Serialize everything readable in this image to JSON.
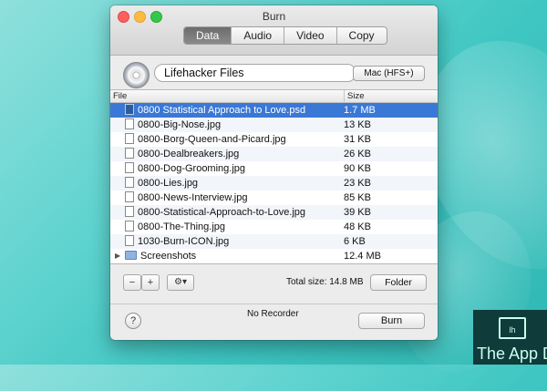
{
  "window": {
    "title": "Burn",
    "tabs": [
      {
        "label": "Data",
        "active": true
      },
      {
        "label": "Audio",
        "active": false
      },
      {
        "label": "Video",
        "active": false
      },
      {
        "label": "Copy",
        "active": false
      }
    ]
  },
  "disc": {
    "name": "Lifehacker Files",
    "filesystem": "Mac (HFS+)"
  },
  "filelist": {
    "columns": [
      "File",
      "Size"
    ],
    "rows": [
      {
        "name": "0800 Statistical Approach to Love.psd",
        "size": "1.7 MB",
        "icon": "psd-file-icon",
        "selected": true
      },
      {
        "name": "0800-Big-Nose.jpg",
        "size": "13 KB",
        "icon": "image-file-icon"
      },
      {
        "name": "0800-Borg-Queen-and-Picard.jpg",
        "size": "31 KB",
        "icon": "image-file-icon"
      },
      {
        "name": "0800-Dealbreakers.jpg",
        "size": "26 KB",
        "icon": "image-file-icon"
      },
      {
        "name": "0800-Dog-Grooming.jpg",
        "size": "90 KB",
        "icon": "image-file-icon"
      },
      {
        "name": "0800-Lies.jpg",
        "size": "23 KB",
        "icon": "image-file-icon"
      },
      {
        "name": "0800-News-Interview.jpg",
        "size": "85 KB",
        "icon": "image-file-icon"
      },
      {
        "name": "0800-Statistical-Approach-to-Love.jpg",
        "size": "39 KB",
        "icon": "image-file-icon"
      },
      {
        "name": "0800-The-Thing.jpg",
        "size": "48 KB",
        "icon": "image-file-icon"
      },
      {
        "name": "1030-Burn-ICON.jpg",
        "size": "6 KB",
        "icon": "image-file-icon"
      },
      {
        "name": "Screenshots",
        "size": "12.4 MB",
        "icon": "folder-icon",
        "disclosure": "▶"
      }
    ]
  },
  "toolbar": {
    "remove_label": "−",
    "add_label": "+",
    "action_label": "⚙▾",
    "total_size": "Total size: 14.8 MB",
    "folder_label": "Folder"
  },
  "footer": {
    "help_label": "?",
    "recorder_status": "No Recorder",
    "burn_label": "Burn"
  },
  "watermark": {
    "screen_text": "lh",
    "text": "The App D"
  },
  "colors": {
    "selection": "#3a78d6",
    "desktop": "#3fc6c2"
  }
}
